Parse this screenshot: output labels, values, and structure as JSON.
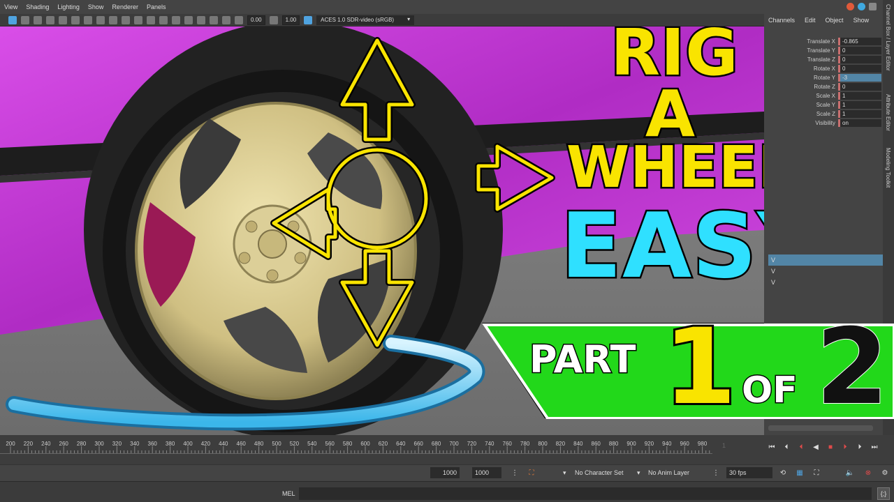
{
  "viewport": {
    "menus": [
      "View",
      "Shading",
      "Lighting",
      "Show",
      "Renderer",
      "Panels"
    ],
    "toolbar": {
      "exposure": "0.00",
      "gamma": "1.00",
      "color_space": "ACES 1.0 SDR-video (sRGB)"
    }
  },
  "thumbnail": {
    "title_line1": "RIG",
    "title_line2": "A",
    "title_line3": "WHEEL",
    "title_line4": "EASY!",
    "part_label": "PART",
    "part_number": "1",
    "part_of": "OF",
    "part_total": "2",
    "colors": {
      "title_yellow": "#f9e400",
      "easy_cyan": "#2fe0ff",
      "banner_green": "#22d81a",
      "car_body_magenta": "#c63ad6",
      "wheel_gold": "#d8c98a",
      "curve_blue": "#5cc8f0"
    }
  },
  "channel_box": {
    "menus": [
      "Channels",
      "Edit",
      "Object",
      "Show"
    ],
    "attributes": [
      {
        "name": "Translate X",
        "value": "-0.865"
      },
      {
        "name": "Translate Y",
        "value": "0"
      },
      {
        "name": "Translate Z",
        "value": "0"
      },
      {
        "name": "Rotate X",
        "value": "0"
      },
      {
        "name": "Rotate Y",
        "value": "-3"
      },
      {
        "name": "Rotate Z",
        "value": "0"
      },
      {
        "name": "Scale X",
        "value": "1"
      },
      {
        "name": "Scale Y",
        "value": "1"
      },
      {
        "name": "Scale Z",
        "value": "1"
      },
      {
        "name": "Visibility",
        "value": "on"
      }
    ],
    "layer_rows": [
      "V",
      "V",
      "V"
    ],
    "side_tabs": [
      "Channel Box / Layer Editor",
      "Attribute Editor",
      "Modeling Toolkit"
    ]
  },
  "timeline": {
    "ticks": [
      "200",
      "220",
      "240",
      "260",
      "280",
      "300",
      "320",
      "340",
      "360",
      "380",
      "400",
      "420",
      "440",
      "460",
      "480",
      "500",
      "520",
      "540",
      "560",
      "580",
      "600",
      "620",
      "640",
      "660",
      "680",
      "700",
      "720",
      "740",
      "760",
      "780",
      "800",
      "820",
      "840",
      "860",
      "880",
      "900",
      "920",
      "940",
      "960",
      "980"
    ],
    "current_frame": "1"
  },
  "range_bar": {
    "end_time": "1000",
    "playback_end": "1000",
    "character_set": "No Character Set",
    "anim_layer": "No Anim Layer",
    "fps": "30 fps"
  },
  "command_line": {
    "label": "MEL"
  }
}
